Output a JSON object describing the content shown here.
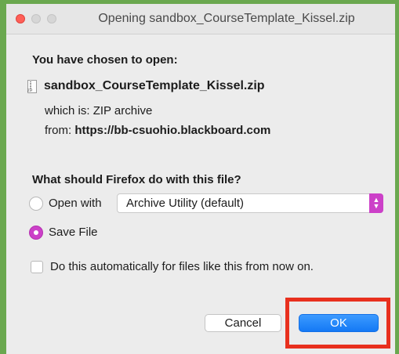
{
  "window": {
    "title": "Opening sandbox_CourseTemplate_Kissel.zip"
  },
  "dialog": {
    "heading": "You have chosen to open:",
    "file": {
      "name": "sandbox_CourseTemplate_Kissel.zip",
      "icon": "zip-file-icon"
    },
    "which_is": {
      "label": "which is:",
      "value": "ZIP archive"
    },
    "from": {
      "label": "from:",
      "value": "https://bb-csuohio.blackboard.com"
    },
    "question": "What should Firefox do with this file?",
    "options": {
      "open_with": {
        "label": "Open with",
        "selected": false,
        "app_select_value": "Archive Utility (default)"
      },
      "save_file": {
        "label": "Save File",
        "selected": true
      }
    },
    "auto_checkbox": {
      "label": "Do this automatically for files like this from now on.",
      "checked": false
    },
    "buttons": {
      "cancel": "Cancel",
      "ok": "OK"
    }
  },
  "colors": {
    "accent": "#cc40c8",
    "ok_button": "#1479f5",
    "highlight_border": "#e8301e",
    "frame_border": "#6aa84f"
  }
}
